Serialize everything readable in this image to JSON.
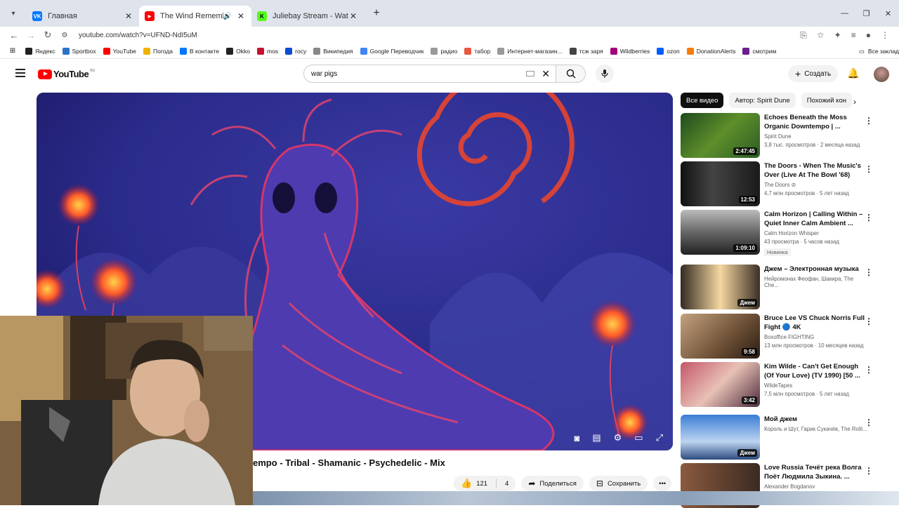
{
  "browser": {
    "tabs": [
      {
        "title": "Главная",
        "fav_color": "#0077ff",
        "fav_text": "VK"
      },
      {
        "title": "The Wind Remembers Folk",
        "fav_color": "#ff0000",
        "fav_text": "▶"
      },
      {
        "title": "Juliebay Stream - Watch Live o",
        "fav_color": "#53fc18",
        "fav_text": "K"
      }
    ],
    "url": "youtube.com/watch?v=UFND-NdI5uM",
    "bookmarks": [
      {
        "label": "Яндекс",
        "color": "#222"
      },
      {
        "label": "Sportbox",
        "color": "#2a73c9"
      },
      {
        "label": "YouTube",
        "color": "#ff0000"
      },
      {
        "label": "Погода",
        "color": "#f0b400"
      },
      {
        "label": "В контакте",
        "color": "#0077ff"
      },
      {
        "label": "Okko",
        "color": "#222"
      },
      {
        "label": "mos",
        "color": "#c8102e"
      },
      {
        "label": "госу",
        "color": "#0d4cd3"
      },
      {
        "label": "Википедия",
        "color": "#888"
      },
      {
        "label": "Google Переводчик",
        "color": "#4285f4"
      },
      {
        "label": "радио",
        "color": "#999"
      },
      {
        "label": "табор",
        "color": "#e8573f"
      },
      {
        "label": "Интернет-магазин...",
        "color": "#999"
      },
      {
        "label": "тсж заря",
        "color": "#444"
      },
      {
        "label": "Wildberries",
        "color": "#a3007a"
      },
      {
        "label": "ozon",
        "color": "#005bff"
      },
      {
        "label": "DonationAlerts",
        "color": "#f57d07"
      },
      {
        "label": "смотрим",
        "color": "#6b1e8c"
      }
    ],
    "bookmarks_right": "Все заклад"
  },
  "youtube": {
    "logo": "YouTube",
    "logo_region": "RU",
    "search_value": "war pigs",
    "create_label": "Создать",
    "video_title": "empo - Tribal - Shamanic - Psychedelic - Mix",
    "likes": "121",
    "comments_count": "4",
    "share_label": "Поделиться",
    "save_label": "Сохранить"
  },
  "chips": [
    "Все видео",
    "Автор: Spirit Dune",
    "Похожий кон"
  ],
  "recommendations": [
    {
      "title": "Echoes Beneath the Moss Organic Downtempo | ...",
      "channel": "Spirit Dune",
      "stats": "3,8 тыс. просмотров · 2 месяца назад",
      "duration": "2:47:45",
      "thumb": "moss"
    },
    {
      "title": "The Doors - When The Music's Over (Live At The Bowl '68)",
      "channel": "The Doors ⊘",
      "stats": "4,7 млн просмотров · 5 лет назад",
      "duration": "12:53",
      "thumb": "doors"
    },
    {
      "title": "Calm Horizon | Calling Within – Quiet Inner Calm Ambient ...",
      "channel": "Calm Horizon Whisper",
      "stats": "43 просмотра · 5 часов назад",
      "duration": "1:09:10",
      "badge": "Новинка",
      "thumb": "calm"
    },
    {
      "title": "Джем – Электронная музыка",
      "channel": "Нейромонах Феофан, Шакира, The Che...",
      "stats": "",
      "duration": "Джем",
      "thumb": "jem"
    },
    {
      "title": "Bruce Lee VS Chuck Norris Full Fight 🔵 4K",
      "channel": "Boxoffice FIGHTING",
      "stats": "13 млн просмотров · 10 месяцев назад",
      "duration": "9:58",
      "thumb": "bruce"
    },
    {
      "title": "Kim Wilde - Can't Get Enough (Of Your Love) (TV 1990) [50 ...",
      "channel": "WildeTapes",
      "stats": "7,5 млн просмотров · 5 лет назад",
      "duration": "3:42",
      "thumb": "kim"
    },
    {
      "title": "Мой джем",
      "channel": "Король и Шут, Гарик Сукачёв, The Rolli...",
      "stats": "",
      "duration": "Джем",
      "thumb": "myjem"
    },
    {
      "title": "Love Russia Течёт река Волга Поёт Людмила Зыкина. ...",
      "channel": "Alexander Bogdanov",
      "stats": "",
      "duration": "",
      "thumb": "volga"
    }
  ],
  "colors": {
    "brand_red": "#ff0000",
    "chip_active": "#0f0f0f"
  }
}
